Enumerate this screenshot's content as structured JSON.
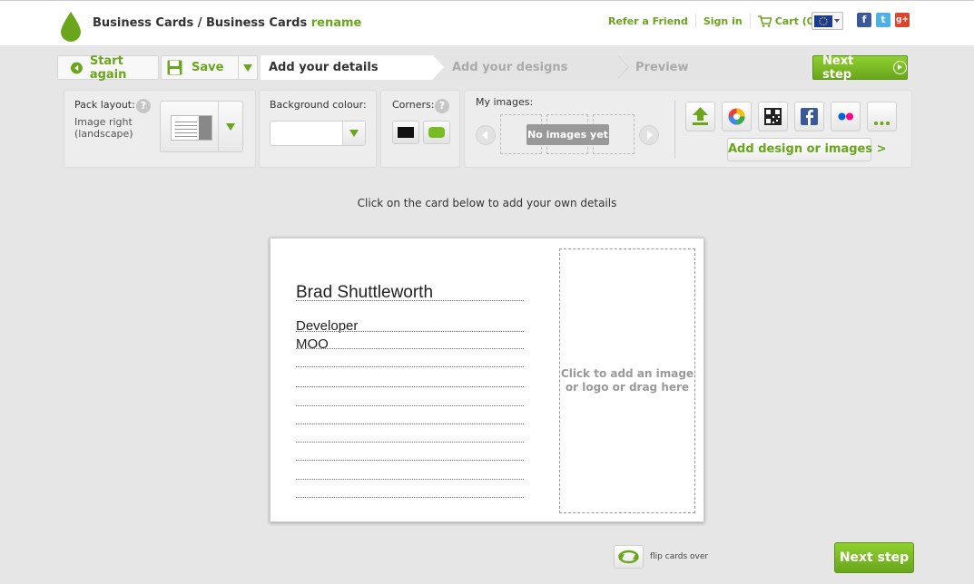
{
  "header": {
    "breadcrumb": "Business Cards / Business Cards",
    "rename_link": "rename",
    "refer_friend": "Refer a Friend",
    "sign_in": "Sign in",
    "cart": "Cart (0)"
  },
  "stepbar": {
    "start_again": "Start again",
    "save": "Save",
    "steps": [
      "Add your details",
      "Add your designs",
      "Preview"
    ],
    "active_step": 0,
    "next_step": "Next step"
  },
  "options": {
    "pack_layout_label": "Pack layout:",
    "pack_layout_value": "Image right (landscape)",
    "background_label": "Background colour:",
    "background_value": "",
    "corners_label": "Corners:",
    "my_images_label": "My images:",
    "no_images": "No images yet",
    "add_design": "Add design or images >"
  },
  "main": {
    "instruction": "Click on the card below to add your own details",
    "card": {
      "name": "Brad Shuttleworth",
      "title": "Developer",
      "company": "MOO",
      "image_placeholder_line1": "Click to add an image",
      "image_placeholder_line2": "or logo or drag here"
    },
    "flip_label": "flip cards over",
    "next_step": "Next step"
  },
  "colors": {
    "accent": "#6aa51c",
    "button_green": "#7dbb26"
  }
}
